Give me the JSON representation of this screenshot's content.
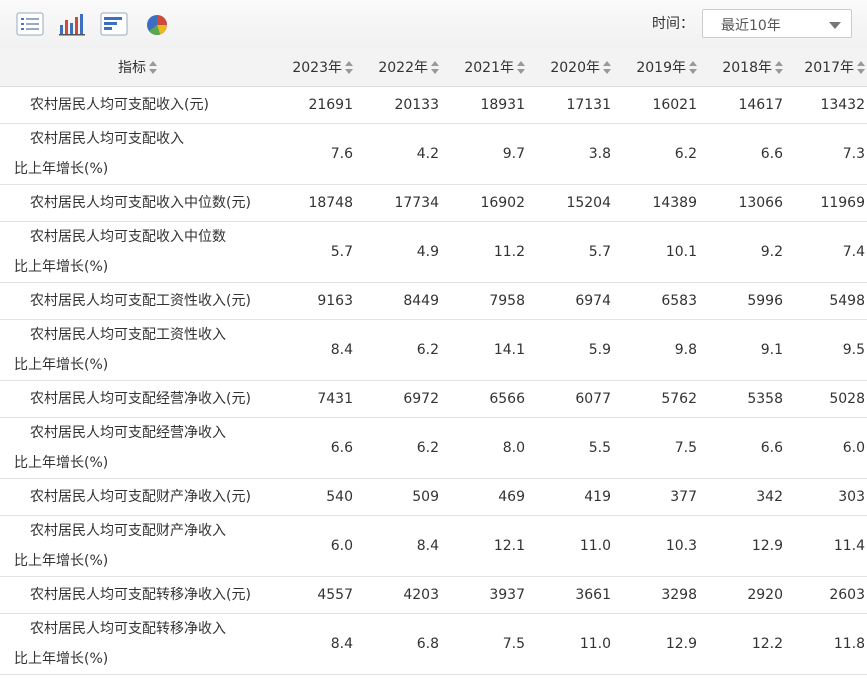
{
  "toolbar": {
    "buttons": [
      {
        "name": "table-view-icon"
      },
      {
        "name": "bar-chart-icon"
      },
      {
        "name": "horizontal-bar-icon"
      },
      {
        "name": "pie-chart-icon"
      }
    ],
    "time_label": "时间：",
    "time_select_value": "最近10年"
  },
  "table": {
    "indicator_header": "指标",
    "years": [
      "2023年",
      "2022年",
      "2021年",
      "2020年",
      "2019年",
      "2018年",
      "2017年"
    ],
    "rows": [
      {
        "line1": "农村居民人均可支配收入(元)",
        "line2": "",
        "values": [
          "21691",
          "20133",
          "18931",
          "17131",
          "16021",
          "14617",
          "13432"
        ]
      },
      {
        "line1": "农村居民人均可支配收入",
        "line2": "比上年增长(%)",
        "values": [
          "7.6",
          "4.2",
          "9.7",
          "3.8",
          "6.2",
          "6.6",
          "7.3"
        ]
      },
      {
        "line1": "农村居民人均可支配收入中位数(元)",
        "line2": "",
        "values": [
          "18748",
          "17734",
          "16902",
          "15204",
          "14389",
          "13066",
          "11969"
        ]
      },
      {
        "line1": "农村居民人均可支配收入中位数",
        "line2": "比上年增长(%)",
        "values": [
          "5.7",
          "4.9",
          "11.2",
          "5.7",
          "10.1",
          "9.2",
          "7.4"
        ]
      },
      {
        "line1": "农村居民人均可支配工资性收入(元)",
        "line2": "",
        "values": [
          "9163",
          "8449",
          "7958",
          "6974",
          "6583",
          "5996",
          "5498"
        ]
      },
      {
        "line1": "农村居民人均可支配工资性收入",
        "line2": "比上年增长(%)",
        "values": [
          "8.4",
          "6.2",
          "14.1",
          "5.9",
          "9.8",
          "9.1",
          "9.5"
        ]
      },
      {
        "line1": "农村居民人均可支配经营净收入(元)",
        "line2": "",
        "values": [
          "7431",
          "6972",
          "6566",
          "6077",
          "5762",
          "5358",
          "5028"
        ]
      },
      {
        "line1": "农村居民人均可支配经营净收入",
        "line2": "比上年增长(%)",
        "values": [
          "6.6",
          "6.2",
          "8.0",
          "5.5",
          "7.5",
          "6.6",
          "6.0"
        ]
      },
      {
        "line1": "农村居民人均可支配财产净收入(元)",
        "line2": "",
        "values": [
          "540",
          "509",
          "469",
          "419",
          "377",
          "342",
          "303"
        ]
      },
      {
        "line1": "农村居民人均可支配财产净收入",
        "line2": "比上年增长(%)",
        "values": [
          "6.0",
          "8.4",
          "12.1",
          "11.0",
          "10.3",
          "12.9",
          "11.4"
        ]
      },
      {
        "line1": "农村居民人均可支配转移净收入(元)",
        "line2": "",
        "values": [
          "4557",
          "4203",
          "3937",
          "3661",
          "3298",
          "2920",
          "2603"
        ]
      },
      {
        "line1": "农村居民人均可支配转移净收入",
        "line2": "比上年增长(%)",
        "values": [
          "8.4",
          "6.8",
          "7.5",
          "11.0",
          "12.9",
          "12.2",
          "11.8"
        ]
      }
    ]
  }
}
